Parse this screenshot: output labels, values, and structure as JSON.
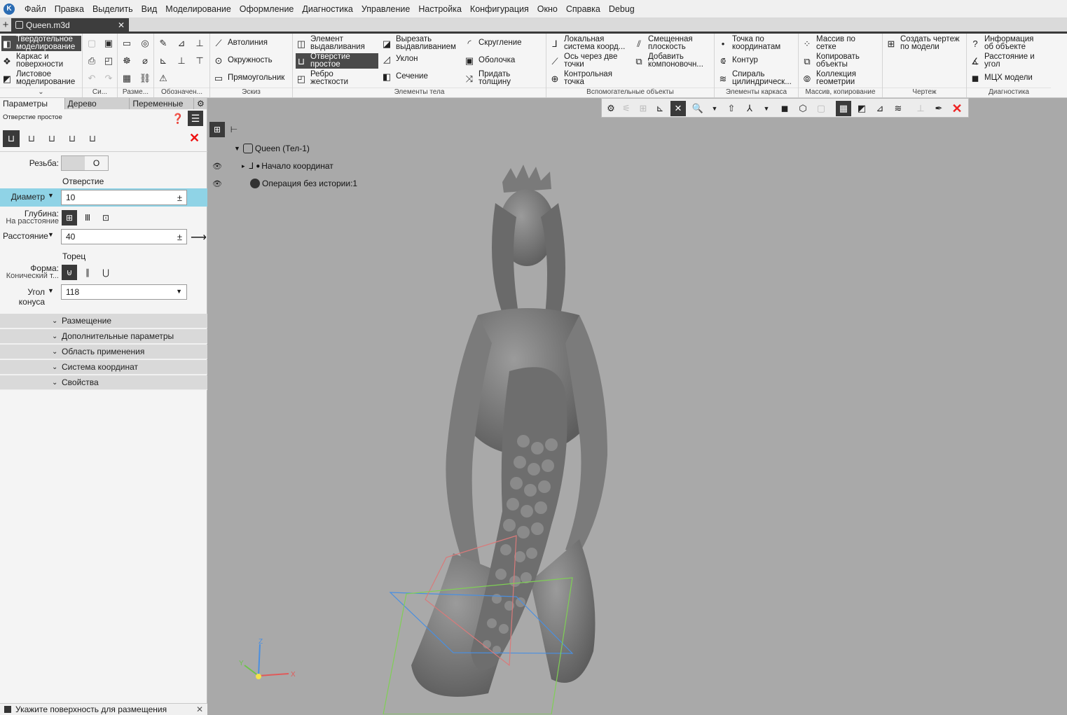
{
  "menu": {
    "items": [
      "Файл",
      "Правка",
      "Выделить",
      "Вид",
      "Моделирование",
      "Оформление",
      "Диагностика",
      "Управление",
      "Настройка",
      "Конфигурация",
      "Окно",
      "Справка",
      "Debug"
    ]
  },
  "doc_tab": {
    "title": "Queen.m3d",
    "close": "✕",
    "add": "+"
  },
  "ribbon": {
    "modes": [
      "Твердотельное моделирование",
      "Каркас и поверхности",
      "Листовое моделирование"
    ],
    "groups": {
      "si": "Си...",
      "razme": "Разме...",
      "oboznach": "Обозначен...",
      "sketch": "Эскиз",
      "body": "Элементы тела",
      "aux": "Вспомогательные объекты",
      "frame": "Элементы каркаса",
      "array": "Массив, копирование",
      "drawing": "Чертеж",
      "diag": "Диагностика"
    },
    "sketch": [
      "Автолиния",
      "Окружность",
      "Прямоугольник"
    ],
    "body_col1": [
      "Элемент выдавливания",
      "Отверстие простое",
      "Ребро жесткости"
    ],
    "body_col2": [
      "Вырезать выдавливанием",
      "Уклон",
      "Сечение"
    ],
    "body_col3": [
      "Скругление",
      "Оболочка",
      "Придать толщину"
    ],
    "aux_col1": [
      "Локальная система коорд...",
      "Ось через две точки",
      "Контрольная точка"
    ],
    "aux_col2": [
      "Смещенная плоскость",
      "Добавить компоновочн..."
    ],
    "frame": [
      "Точка по координатам",
      "Контур",
      "Спираль цилиндрическ..."
    ],
    "array": [
      "Массив по сетке",
      "Копировать объекты",
      "Коллекция геометрии"
    ],
    "drawing": [
      "Создать чертеж по модели"
    ],
    "diag": [
      "Информация об объекте",
      "Расстояние и угол",
      "МЦХ модели"
    ]
  },
  "panel": {
    "tabs": [
      "Параметры",
      "Дерево",
      "Переменные"
    ],
    "title": "Отверстие простое",
    "thread_label": "Резьба:",
    "thread_toggle": "O",
    "section_hole": "Отверстие",
    "diameter_label": "Диаметр",
    "diameter_value": "10",
    "depth_label": "Глубина:",
    "depth_sub": "На расстояние",
    "distance_label": "Расстояние",
    "distance_value": "40",
    "section_end": "Торец",
    "shape_label": "Форма:",
    "shape_sub": "Конический т...",
    "cone_label": "Угол конуса",
    "cone_value": "118",
    "pm": "±",
    "collapsibles": [
      "Размещение",
      "Дополнительные параметры",
      "Область применения",
      "Система координат",
      "Свойства"
    ]
  },
  "status": {
    "text": "Укажите поверхность для размещения"
  },
  "tree": {
    "root": "Queen (Тел-1)",
    "items": [
      "Начало координат",
      "Операция без истории:1"
    ]
  },
  "axes": {
    "x": "X",
    "y": "Y",
    "z": "Z"
  },
  "colors": {
    "accent": "#8fd3e6",
    "dark": "#3a3a3a",
    "close_red": "#e11b1b"
  }
}
